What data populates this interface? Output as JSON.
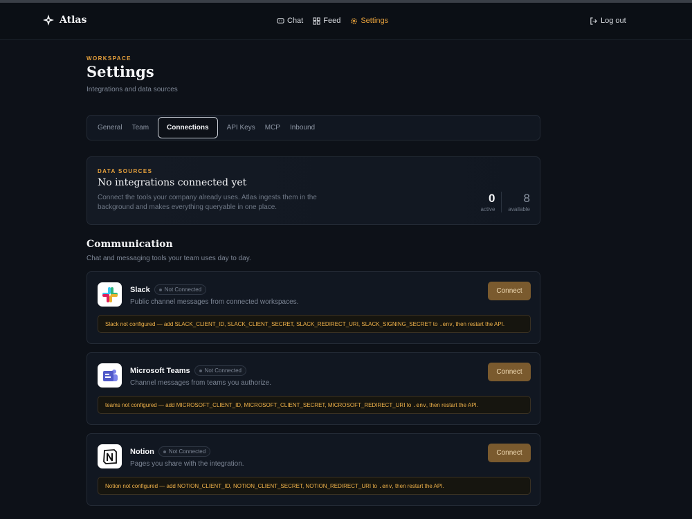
{
  "brand": {
    "name": "Atlas"
  },
  "nav": {
    "links": [
      {
        "label": "Chat",
        "icon": "chat-icon"
      },
      {
        "label": "Feed",
        "icon": "grid-icon"
      },
      {
        "label": "Settings",
        "icon": "gear-icon",
        "active": true
      }
    ],
    "logout_label": "Log out"
  },
  "page": {
    "eyebrow": "WORKSPACE",
    "title": "Settings",
    "subtitle": "Integrations and data sources"
  },
  "tabs": [
    "General",
    "Team",
    "Connections",
    "API Keys",
    "MCP",
    "Inbound"
  ],
  "active_tab": "Connections",
  "hero": {
    "eyebrow": "DATA SOURCES",
    "title": "No integrations connected yet",
    "description": "Connect the tools your company already uses. Atlas ingests them in the background and makes everything queryable in one place.",
    "active_count": "0",
    "active_label": "active",
    "available_count": "8",
    "available_label": "available"
  },
  "section": {
    "title": "Communication",
    "subtitle": "Chat and messaging tools your team uses day to day."
  },
  "integrations": [
    {
      "name": "Slack",
      "status": "Not Connected",
      "description": "Public channel messages from connected workspaces.",
      "button": "Connect",
      "warning_pre": "Slack not configured — add SLACK_CLIENT_ID, SLACK_CLIENT_SECRET, SLACK_REDIRECT_URI, SLACK_SIGNING_SECRET to",
      "warning_code": ".env",
      "warning_post": ", then restart the API."
    },
    {
      "name": "Microsoft Teams",
      "status": "Not Connected",
      "description": "Channel messages from teams you authorize.",
      "button": "Connect",
      "warning_pre": "teams not configured — add MICROSOFT_CLIENT_ID, MICROSOFT_CLIENT_SECRET, MICROSOFT_REDIRECT_URI to",
      "warning_code": ".env",
      "warning_post": ", then restart the API."
    },
    {
      "name": "Notion",
      "status": "Not Connected",
      "description": "Pages you share with the integration.",
      "button": "Connect",
      "warning_pre": "Notion not configured — add NOTION_CLIENT_ID, NOTION_CLIENT_SECRET, NOTION_REDIRECT_URI to",
      "warning_code": ".env",
      "warning_post": ", then restart the API."
    }
  ],
  "colors": {
    "accent": "#e8a23c",
    "connect_button": "#7a5a2e",
    "warning_text": "#f0b24a"
  }
}
